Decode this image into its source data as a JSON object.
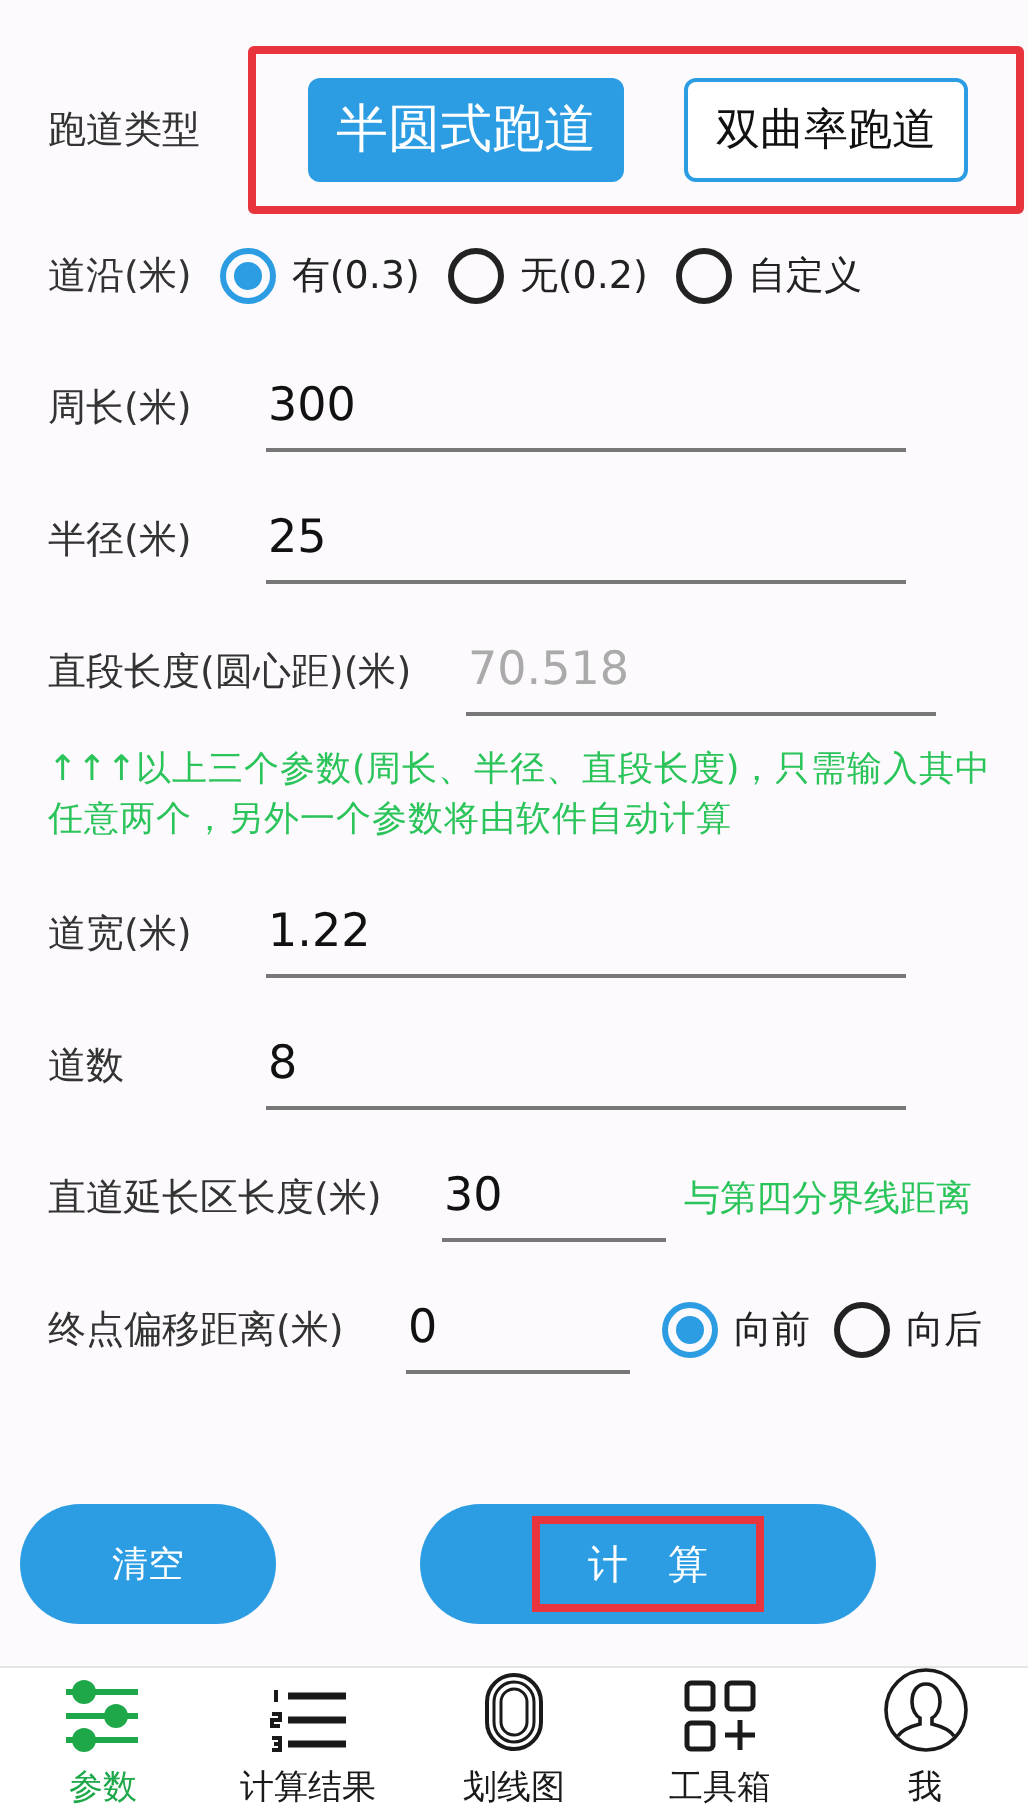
{
  "rows": [
    {
      "kind": "segmented",
      "label": "跑道类型",
      "highlighted": true,
      "options": [
        {
          "label": "半圆式跑道",
          "selected": true
        },
        {
          "label": "双曲率跑道",
          "selected": false
        }
      ]
    },
    {
      "kind": "radio",
      "label": "道沿(米)",
      "options": [
        {
          "label": "有(0.3)",
          "selected": true
        },
        {
          "label": "无(0.2)",
          "selected": false
        },
        {
          "label": "自定义",
          "selected": false
        }
      ]
    },
    {
      "kind": "input",
      "label": "周长(米)",
      "value": "300",
      "disabled": false
    },
    {
      "kind": "input",
      "label": "半径(米)",
      "value": "25",
      "disabled": false
    },
    {
      "kind": "input",
      "label": "直段长度(圆心距)(米)",
      "value": "70.518",
      "disabled": true
    },
    {
      "kind": "note",
      "text": "↑↑↑以上三个参数(周长、半径、直段长度)，只需输入其中任意两个，另外一个参数将由软件自动计算"
    },
    {
      "kind": "input",
      "label": "道宽(米)",
      "value": "1.22",
      "disabled": false
    },
    {
      "kind": "input",
      "label": "道数",
      "value": "8",
      "disabled": false
    },
    {
      "kind": "input_note",
      "label": "直道延长区长度(米)",
      "value": "30",
      "note": "与第四分界线距离"
    },
    {
      "kind": "input_radio",
      "label": "终点偏移距离(米)",
      "value": "0",
      "options": [
        {
          "label": "向前",
          "selected": true
        },
        {
          "label": "向后",
          "selected": false
        }
      ]
    }
  ],
  "actions": [
    {
      "kind": "clear",
      "label": "清空",
      "highlighted": false
    },
    {
      "kind": "calculate",
      "label": "计　算",
      "highlighted": true
    }
  ],
  "nav": [
    {
      "kind": "sliders",
      "label": "参数",
      "selected": true
    },
    {
      "kind": "list",
      "label": "计算结果",
      "selected": false
    },
    {
      "kind": "track",
      "label": "划线图",
      "selected": false
    },
    {
      "kind": "grid",
      "label": "工具箱",
      "selected": false
    },
    {
      "kind": "user",
      "label": "我",
      "selected": false
    }
  ]
}
